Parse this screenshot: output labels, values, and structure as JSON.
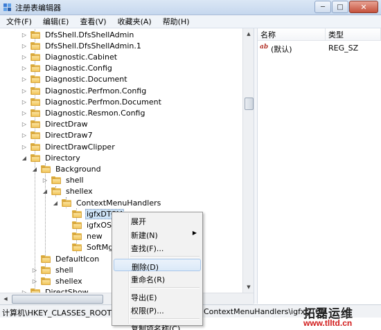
{
  "window": {
    "title": "注册表编辑器",
    "minimize_glyph": "─",
    "maximize_glyph": "□",
    "close_glyph": "✕"
  },
  "menu": {
    "items": [
      "文件(F)",
      "编辑(E)",
      "查看(V)",
      "收藏夹(A)",
      "帮助(H)"
    ]
  },
  "tree": {
    "items": [
      {
        "label": "DfsShell.DfsShellAdmin",
        "level": 0,
        "expander": "▷"
      },
      {
        "label": "DfsShell.DfsShellAdmin.1",
        "level": 0,
        "expander": "▷"
      },
      {
        "label": "Diagnostic.Cabinet",
        "level": 0,
        "expander": "▷"
      },
      {
        "label": "Diagnostic.Config",
        "level": 0,
        "expander": "▷"
      },
      {
        "label": "Diagnostic.Document",
        "level": 0,
        "expander": "▷"
      },
      {
        "label": "Diagnostic.Perfmon.Config",
        "level": 0,
        "expander": "▷"
      },
      {
        "label": "Diagnostic.Perfmon.Document",
        "level": 0,
        "expander": "▷"
      },
      {
        "label": "Diagnostic.Resmon.Config",
        "level": 0,
        "expander": "▷"
      },
      {
        "label": "DirectDraw",
        "level": 0,
        "expander": "▷"
      },
      {
        "label": "DirectDraw7",
        "level": 0,
        "expander": "▷"
      },
      {
        "label": "DirectDrawClipper",
        "level": 0,
        "expander": "▷"
      },
      {
        "label": "Directory",
        "level": 0,
        "expander": "◢"
      },
      {
        "label": "Background",
        "level": 1,
        "expander": "◢"
      },
      {
        "label": "shell",
        "level": 2,
        "expander": "▷"
      },
      {
        "label": "shellex",
        "level": 2,
        "expander": "◢"
      },
      {
        "label": "ContextMenuHandlers",
        "level": 3,
        "expander": "◢"
      },
      {
        "label": "igfxDTCM",
        "level": 4,
        "expander": "",
        "selected": true
      },
      {
        "label": "igfxOSP",
        "level": 4,
        "expander": ""
      },
      {
        "label": "new",
        "level": 4,
        "expander": ""
      },
      {
        "label": "SoftMgr",
        "level": 4,
        "expander": ""
      },
      {
        "label": "DefaultIcon",
        "level": 1,
        "expander": ""
      },
      {
        "label": "shell",
        "level": 1,
        "expander": "▷"
      },
      {
        "label": "shellex",
        "level": 1,
        "expander": "▷"
      },
      {
        "label": "DirectShow",
        "level": 0,
        "expander": "▷"
      }
    ]
  },
  "scroll": {
    "up_glyph": "▲",
    "down_glyph": "▼",
    "left_glyph": "◀"
  },
  "values": {
    "headers": {
      "name": "名称",
      "type": "类型"
    },
    "rows": [
      {
        "icon": "ab",
        "name": "(默认)",
        "type": "REG_SZ"
      }
    ]
  },
  "status": {
    "left": "计算机\\HKEY_CLASSES_ROOT\\Directory\\Background\\shellex\\ContextMenuHandlers\\igfxDTCM",
    "right": "ContextMenuHandlers\\igfxDTCM"
  },
  "context_menu": {
    "items": [
      {
        "label": "展开",
        "group": 0
      },
      {
        "label": "新建(N)",
        "group": 0,
        "submenu": true,
        "arrow": "▶"
      },
      {
        "label": "查找(F)...",
        "group": 0
      },
      {
        "label": "删除(D)",
        "group": 1,
        "hover": true
      },
      {
        "label": "重命名(R)",
        "group": 1
      },
      {
        "label": "导出(E)",
        "group": 2
      },
      {
        "label": "权限(P)...",
        "group": 2
      },
      {
        "label": "复制项名称(C)",
        "group": 3
      }
    ]
  },
  "watermark": {
    "cn": "拓磊运维",
    "url": "www.tlltd.cn"
  },
  "colors": {
    "selection": "#cde3f7",
    "folder": "#f1c65a",
    "close_button": "#c5513c",
    "watermark_url": "#d11b1b"
  }
}
